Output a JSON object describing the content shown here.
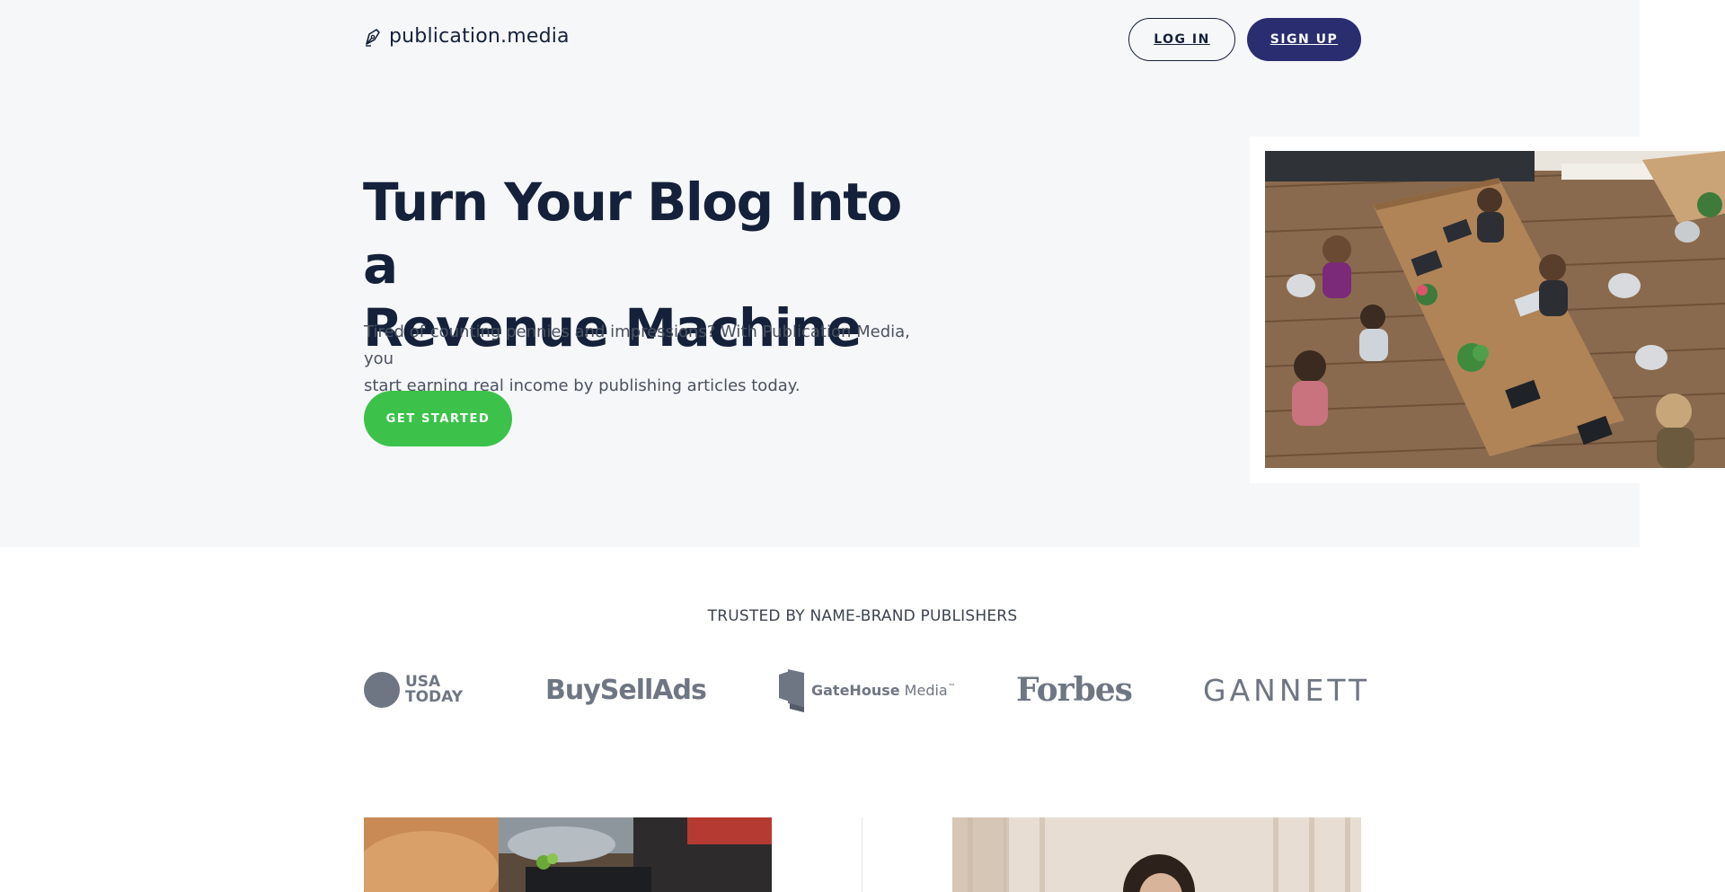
{
  "header": {
    "logo_text": "publication.media",
    "logo_icon": "pen-nib-icon",
    "login_label": "LOG IN",
    "signup_label": "SIGN UP"
  },
  "hero": {
    "headline_line1": "Turn Your Blog Into a",
    "headline_line2": "Revenue Machine",
    "subtext_line1": "Tired of counting pennies and impressions? With Publication Media, you",
    "subtext_line2": "start earning real income by publishing articles today.",
    "cta_label": "GET STARTED"
  },
  "trusted": {
    "title": "TRUSTED BY NAME-BRAND PUBLISHERS",
    "brands": {
      "usatoday_line1": "USA",
      "usatoday_line2": "TODAY",
      "buysellads": "BuySellAds",
      "gatehouse_bold": "GateHouse",
      "gatehouse_rest": " Media",
      "gatehouse_tm": "™",
      "forbes": "Forbes",
      "gannett": "GANNETT"
    }
  },
  "colors": {
    "hero_bg": "#f6f7f9",
    "navy": "#15213a",
    "signup_bg": "#2a2d6f",
    "cta_green": "#3cc24a",
    "brand_gray": "#6f7683"
  }
}
